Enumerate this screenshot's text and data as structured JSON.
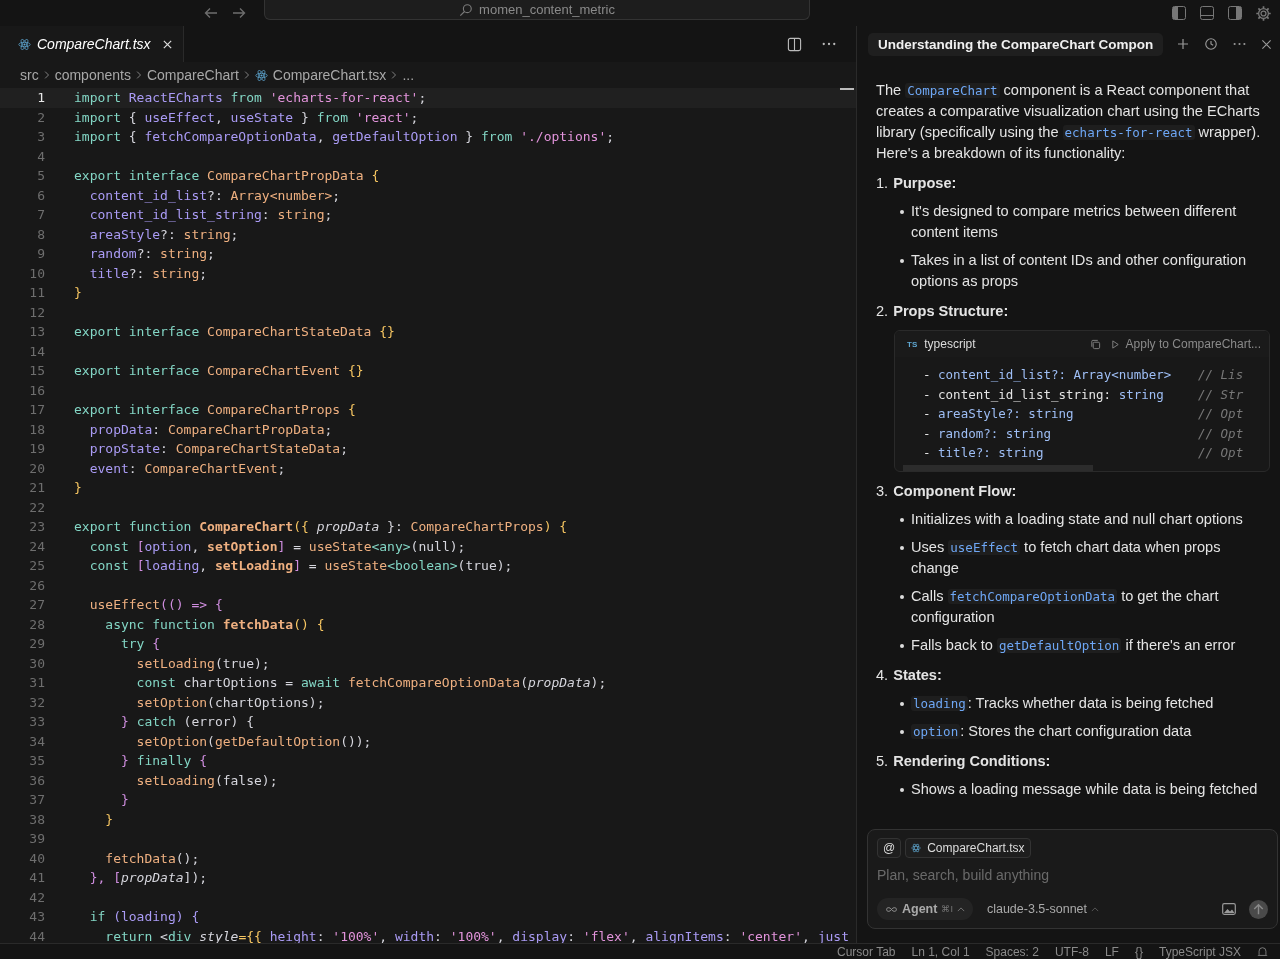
{
  "topbar": {
    "search": "momen_content_metric"
  },
  "editor": {
    "tab": {
      "label": "CompareChart.tsx",
      "selected": true
    },
    "breadcrumb": [
      {
        "label": "src",
        "kind": "folder"
      },
      {
        "label": "components",
        "kind": "folder"
      },
      {
        "label": "CompareChart",
        "kind": "folder"
      },
      {
        "label": "CompareChart.tsx",
        "kind": "file"
      },
      {
        "label": "...",
        "kind": "more"
      }
    ],
    "lines": [
      {
        "n": "1",
        "current": true,
        "tokens": [
          {
            "t": "import ",
            "kind": "keyword"
          },
          {
            "t": "ReactECharts ",
            "kind": "variable"
          },
          {
            "t": "from ",
            "kind": "keyword"
          },
          {
            "t": "'echarts-for-react'",
            "kind": "string"
          },
          {
            "t": ";",
            "kind": "plain"
          }
        ]
      },
      {
        "n": "2",
        "current": false,
        "tokens": [
          {
            "t": "import ",
            "kind": "keyword"
          },
          {
            "t": "{ ",
            "kind": "plain"
          },
          {
            "t": "useEffect",
            "kind": "variable"
          },
          {
            "t": ", ",
            "kind": "plain"
          },
          {
            "t": "useState ",
            "kind": "variable"
          },
          {
            "t": "} ",
            "kind": "plain"
          },
          {
            "t": "from ",
            "kind": "keyword"
          },
          {
            "t": "'react'",
            "kind": "string"
          },
          {
            "t": ";",
            "kind": "plain"
          }
        ]
      },
      {
        "n": "3",
        "current": false,
        "tokens": [
          {
            "t": "import ",
            "kind": "keyword"
          },
          {
            "t": "{ ",
            "kind": "plain"
          },
          {
            "t": "fetchCompareOptionData",
            "kind": "variable"
          },
          {
            "t": ", ",
            "kind": "plain"
          },
          {
            "t": "getDefaultOption ",
            "kind": "variable"
          },
          {
            "t": "} ",
            "kind": "plain"
          },
          {
            "t": "from ",
            "kind": "keyword"
          },
          {
            "t": "'./options'",
            "kind": "string"
          },
          {
            "t": ";",
            "kind": "plain"
          }
        ]
      },
      {
        "n": "4",
        "current": false
      },
      {
        "n": "5",
        "current": false,
        "tokens": [
          {
            "t": "export interface ",
            "kind": "keyword"
          },
          {
            "t": "CompareChartPropData ",
            "kind": "type"
          },
          {
            "t": "{",
            "kind": "brace"
          }
        ]
      },
      {
        "n": "6",
        "current": false,
        "tokens": [
          {
            "t": "  content_id_list",
            "kind": "variable"
          },
          {
            "t": "?: ",
            "kind": "plain"
          },
          {
            "t": "Array<number>",
            "kind": "type"
          },
          {
            "t": ";",
            "kind": "plain"
          }
        ]
      },
      {
        "n": "7",
        "current": false,
        "tokens": [
          {
            "t": "  content_id_list_string",
            "kind": "variable"
          },
          {
            "t": ": ",
            "kind": "plain"
          },
          {
            "t": "string",
            "kind": "type"
          },
          {
            "t": ";",
            "kind": "plain"
          }
        ]
      },
      {
        "n": "8",
        "current": false,
        "tokens": [
          {
            "t": "  areaStyle",
            "kind": "variable"
          },
          {
            "t": "?: ",
            "kind": "plain"
          },
          {
            "t": "string",
            "kind": "type"
          },
          {
            "t": ";",
            "kind": "plain"
          }
        ]
      },
      {
        "n": "9",
        "current": false,
        "tokens": [
          {
            "t": "  random",
            "kind": "variable"
          },
          {
            "t": "?: ",
            "kind": "plain"
          },
          {
            "t": "string",
            "kind": "type"
          },
          {
            "t": ";",
            "kind": "plain"
          }
        ]
      },
      {
        "n": "10",
        "current": false,
        "tokens": [
          {
            "t": "  title",
            "kind": "variable"
          },
          {
            "t": "?: ",
            "kind": "plain"
          },
          {
            "t": "string",
            "kind": "type"
          },
          {
            "t": ";",
            "kind": "plain"
          }
        ]
      },
      {
        "n": "11",
        "current": false,
        "tokens": [
          {
            "t": "}",
            "kind": "brace"
          }
        ]
      },
      {
        "n": "12",
        "current": false
      },
      {
        "n": "13",
        "current": false,
        "tokens": [
          {
            "t": "export interface ",
            "kind": "keyword"
          },
          {
            "t": "CompareChartStateData ",
            "kind": "type"
          },
          {
            "t": "{}",
            "kind": "brace"
          }
        ]
      },
      {
        "n": "14",
        "current": false
      },
      {
        "n": "15",
        "current": false,
        "tokens": [
          {
            "t": "export interface ",
            "kind": "keyword"
          },
          {
            "t": "CompareChartEvent ",
            "kind": "type"
          },
          {
            "t": "{}",
            "kind": "brace"
          }
        ]
      },
      {
        "n": "16",
        "current": false
      },
      {
        "n": "17",
        "current": false,
        "tokens": [
          {
            "t": "export interface ",
            "kind": "keyword"
          },
          {
            "t": "CompareChartProps ",
            "kind": "type"
          },
          {
            "t": "{",
            "kind": "brace"
          }
        ]
      },
      {
        "n": "18",
        "current": false,
        "tokens": [
          {
            "t": "  propData",
            "kind": "variable"
          },
          {
            "t": ": ",
            "kind": "plain"
          },
          {
            "t": "CompareChartPropData",
            "kind": "type"
          },
          {
            "t": ";",
            "kind": "plain"
          }
        ]
      },
      {
        "n": "19",
        "current": false,
        "tokens": [
          {
            "t": "  propState",
            "kind": "variable"
          },
          {
            "t": ": ",
            "kind": "plain"
          },
          {
            "t": "CompareChartStateData",
            "kind": "type"
          },
          {
            "t": ";",
            "kind": "plain"
          }
        ]
      },
      {
        "n": "20",
        "current": false,
        "tokens": [
          {
            "t": "  event",
            "kind": "variable"
          },
          {
            "t": ": ",
            "kind": "plain"
          },
          {
            "t": "CompareChartEvent",
            "kind": "type"
          },
          {
            "t": ";",
            "kind": "plain"
          }
        ]
      },
      {
        "n": "21",
        "current": false,
        "tokens": [
          {
            "t": "}",
            "kind": "brace"
          }
        ]
      },
      {
        "n": "22",
        "current": false
      },
      {
        "n": "23",
        "current": false,
        "tokens": [
          {
            "t": "export function ",
            "kind": "keyword"
          },
          {
            "t": "CompareChart",
            "kind": "bold"
          },
          {
            "t": "({ ",
            "kind": "brace"
          },
          {
            "t": "propData",
            "kind": "italic"
          },
          {
            "t": " }: ",
            "kind": "plain"
          },
          {
            "t": "CompareChartProps",
            "kind": "type"
          },
          {
            "t": ") {",
            "kind": "brace"
          }
        ]
      },
      {
        "n": "24",
        "current": false,
        "tokens": [
          {
            "t": "  const ",
            "kind": "keyword"
          },
          {
            "t": "[",
            "kind": "bracket"
          },
          {
            "t": "option",
            "kind": "variable"
          },
          {
            "t": ", ",
            "kind": "plain"
          },
          {
            "t": "setOption",
            "kind": "bold"
          },
          {
            "t": "]",
            "kind": "bracket"
          },
          {
            "t": " = ",
            "kind": "plain"
          },
          {
            "t": "useState",
            "kind": "type"
          },
          {
            "t": "<any>",
            "kind": "keyword"
          },
          {
            "t": "(null);",
            "kind": "plain"
          }
        ]
      },
      {
        "n": "25",
        "current": false,
        "tokens": [
          {
            "t": "  const ",
            "kind": "keyword"
          },
          {
            "t": "[",
            "kind": "bracket"
          },
          {
            "t": "loading",
            "kind": "variable"
          },
          {
            "t": ", ",
            "kind": "plain"
          },
          {
            "t": "setLoading",
            "kind": "bold"
          },
          {
            "t": "]",
            "kind": "bracket"
          },
          {
            "t": " = ",
            "kind": "plain"
          },
          {
            "t": "useState",
            "kind": "type"
          },
          {
            "t": "<boolean>",
            "kind": "keyword"
          },
          {
            "t": "(true);",
            "kind": "plain"
          }
        ]
      },
      {
        "n": "26",
        "current": false
      },
      {
        "n": "27",
        "current": false,
        "tokens": [
          {
            "t": "  useEffect",
            "kind": "type"
          },
          {
            "t": "(() => {",
            "kind": "bracket"
          }
        ]
      },
      {
        "n": "28",
        "current": false,
        "tokens": [
          {
            "t": "    async function ",
            "kind": "keyword"
          },
          {
            "t": "fetchData",
            "kind": "bold"
          },
          {
            "t": "() {",
            "kind": "brace"
          }
        ]
      },
      {
        "n": "29",
        "current": false,
        "tokens": [
          {
            "t": "      try ",
            "kind": "keyword"
          },
          {
            "t": "{",
            "kind": "bracket"
          }
        ]
      },
      {
        "n": "30",
        "current": false,
        "tokens": [
          {
            "t": "        setLoading",
            "kind": "type"
          },
          {
            "t": "(true);",
            "kind": "plain"
          }
        ]
      },
      {
        "n": "31",
        "current": false,
        "tokens": [
          {
            "t": "        const ",
            "kind": "keyword"
          },
          {
            "t": "chartOptions = ",
            "kind": "plain"
          },
          {
            "t": "await ",
            "kind": "keyword"
          },
          {
            "t": "fetchCompareOptionData",
            "kind": "type"
          },
          {
            "t": "(",
            "kind": "plain"
          },
          {
            "t": "propData",
            "kind": "italic"
          },
          {
            "t": ");",
            "kind": "plain"
          }
        ]
      },
      {
        "n": "32",
        "current": false,
        "tokens": [
          {
            "t": "        setOption",
            "kind": "type"
          },
          {
            "t": "(chartOptions);",
            "kind": "plain"
          }
        ]
      },
      {
        "n": "33",
        "current": false,
        "tokens": [
          {
            "t": "      } ",
            "kind": "bracket"
          },
          {
            "t": "catch ",
            "kind": "keyword"
          },
          {
            "t": "(error) {",
            "kind": "plain"
          }
        ]
      },
      {
        "n": "34",
        "current": false,
        "tokens": [
          {
            "t": "        setOption",
            "kind": "type"
          },
          {
            "t": "(",
            "kind": "plain"
          },
          {
            "t": "getDefaultOption",
            "kind": "type"
          },
          {
            "t": "());",
            "kind": "plain"
          }
        ]
      },
      {
        "n": "35",
        "current": false,
        "tokens": [
          {
            "t": "      } ",
            "kind": "bracket"
          },
          {
            "t": "finally ",
            "kind": "keyword"
          },
          {
            "t": "{",
            "kind": "bracket"
          }
        ]
      },
      {
        "n": "36",
        "current": false,
        "tokens": [
          {
            "t": "        setLoading",
            "kind": "type"
          },
          {
            "t": "(false);",
            "kind": "plain"
          }
        ]
      },
      {
        "n": "37",
        "current": false,
        "tokens": [
          {
            "t": "      }",
            "kind": "bracket"
          }
        ]
      },
      {
        "n": "38",
        "current": false,
        "tokens": [
          {
            "t": "    }",
            "kind": "brace"
          }
        ]
      },
      {
        "n": "39",
        "current": false
      },
      {
        "n": "40",
        "current": false,
        "tokens": [
          {
            "t": "    fetchData",
            "kind": "type"
          },
          {
            "t": "();",
            "kind": "plain"
          }
        ]
      },
      {
        "n": "41",
        "current": false,
        "tokens": [
          {
            "t": "  }, [",
            "kind": "bracket"
          },
          {
            "t": "propData",
            "kind": "italic"
          },
          {
            "t": "]);",
            "kind": "plain"
          }
        ]
      },
      {
        "n": "42",
        "current": false
      },
      {
        "n": "43",
        "current": false,
        "tokens": [
          {
            "t": "  if ",
            "kind": "keyword"
          },
          {
            "t": "(loading) {",
            "kind": "variable"
          }
        ]
      },
      {
        "n": "44",
        "current": false,
        "tokens": [
          {
            "t": "    return ",
            "kind": "keyword"
          },
          {
            "t": "<",
            "kind": "plain"
          },
          {
            "t": "div ",
            "kind": "keyword"
          },
          {
            "t": "style",
            "kind": "italic"
          },
          {
            "t": "={{ ",
            "kind": "brace"
          },
          {
            "t": "height",
            "kind": "variable"
          },
          {
            "t": ": ",
            "kind": "plain"
          },
          {
            "t": "'100%'",
            "kind": "string"
          },
          {
            "t": ", ",
            "kind": "plain"
          },
          {
            "t": "width",
            "kind": "variable"
          },
          {
            "t": ": ",
            "kind": "plain"
          },
          {
            "t": "'100%'",
            "kind": "string"
          },
          {
            "t": ", ",
            "kind": "plain"
          },
          {
            "t": "display",
            "kind": "variable"
          },
          {
            "t": ": ",
            "kind": "plain"
          },
          {
            "t": "'flex'",
            "kind": "string"
          },
          {
            "t": ", ",
            "kind": "plain"
          },
          {
            "t": "alignItems",
            "kind": "variable"
          },
          {
            "t": ": ",
            "kind": "plain"
          },
          {
            "t": "'center'",
            "kind": "string"
          },
          {
            "t": ", ",
            "kind": "plain"
          },
          {
            "t": "just",
            "kind": "variable"
          }
        ]
      }
    ]
  },
  "chat": {
    "title": "Understanding the CompareChart Compon",
    "intro": [
      {
        "t": "The "
      },
      {
        "t": "CompareChart",
        "code": true
      },
      {
        "t": " component is a React component that creates a comparative visualization chart using the ECharts library (specifically using the "
      },
      {
        "t": "echarts-for-react",
        "code": true
      },
      {
        "t": " wrapper). Here's a breakdown of its functionality:"
      }
    ],
    "sections": [
      {
        "num": "1.",
        "title": "Purpose:",
        "bullets": [
          [
            {
              "t": "It's designed to compare metrics between different content items"
            }
          ],
          [
            {
              "t": "Takes in a list of content IDs and other configuration options as props"
            }
          ]
        ]
      },
      {
        "num": "2.",
        "title": "Props Structure:",
        "code_block": {
          "badge": "TS",
          "language": "typescript",
          "apply": "Apply to CompareChart...",
          "lines": [
            {
              "code": [
                {
                  "t": "- ",
                  "kind": "plain"
                },
                {
                  "t": "content_id_list?: Array<number>",
                  "kind": "field"
                }
              ],
              "comment": "// Lis"
            },
            {
              "code": [
                {
                  "t": "- content_id_list_string: ",
                  "kind": "plain"
                },
                {
                  "t": "string",
                  "kind": "field"
                }
              ],
              "comment": "// Str"
            },
            {
              "code": [
                {
                  "t": "- ",
                  "kind": "plain"
                },
                {
                  "t": "areaStyle?: string",
                  "kind": "field"
                }
              ],
              "comment": "// Opt"
            },
            {
              "code": [
                {
                  "t": "- ",
                  "kind": "plain"
                },
                {
                  "t": "random?: string",
                  "kind": "field"
                }
              ],
              "comment": "// Opt"
            },
            {
              "code": [
                {
                  "t": "- ",
                  "kind": "plain"
                },
                {
                  "t": "title?: string",
                  "kind": "field"
                }
              ],
              "comment": "// Opt"
            }
          ]
        }
      },
      {
        "num": "3.",
        "title": "Component Flow:",
        "bullets": [
          [
            {
              "t": "Initializes with a loading state and null chart options"
            }
          ],
          [
            {
              "t": "Uses "
            },
            {
              "t": "useEffect",
              "code": true
            },
            {
              "t": " to fetch chart data when props change"
            }
          ],
          [
            {
              "t": "Calls "
            },
            {
              "t": "fetchCompareOptionData",
              "code": true
            },
            {
              "t": " to get the chart configuration"
            }
          ],
          [
            {
              "t": "Falls back to "
            },
            {
              "t": "getDefaultOption",
              "code": true
            },
            {
              "t": " if there's an error"
            }
          ]
        ]
      },
      {
        "num": "4.",
        "title": "States:",
        "bullets": [
          [
            {
              "t": "loading",
              "code": true
            },
            {
              "t": ": Tracks whether data is being fetched"
            }
          ],
          [
            {
              "t": "option",
              "code": true
            },
            {
              "t": ": Stores the chart configuration data"
            }
          ]
        ]
      },
      {
        "num": "5.",
        "title": "Rendering Conditions:",
        "bullets": [
          [
            {
              "t": "Shows a loading message while data is being fetched"
            }
          ]
        ]
      }
    ],
    "composer": {
      "mention": "@",
      "context_file": "CompareChart.tsx",
      "placeholder": "Plan, search, build anything",
      "mode": "Agent",
      "shortcut": "⌘I",
      "model": "claude-3.5-sonnet"
    }
  },
  "status_bar": [
    "Cursor Tab",
    "Ln 1, Col 1",
    "Spaces: 2",
    "UTF-8",
    "LF",
    "{}",
    "TypeScript JSX"
  ]
}
